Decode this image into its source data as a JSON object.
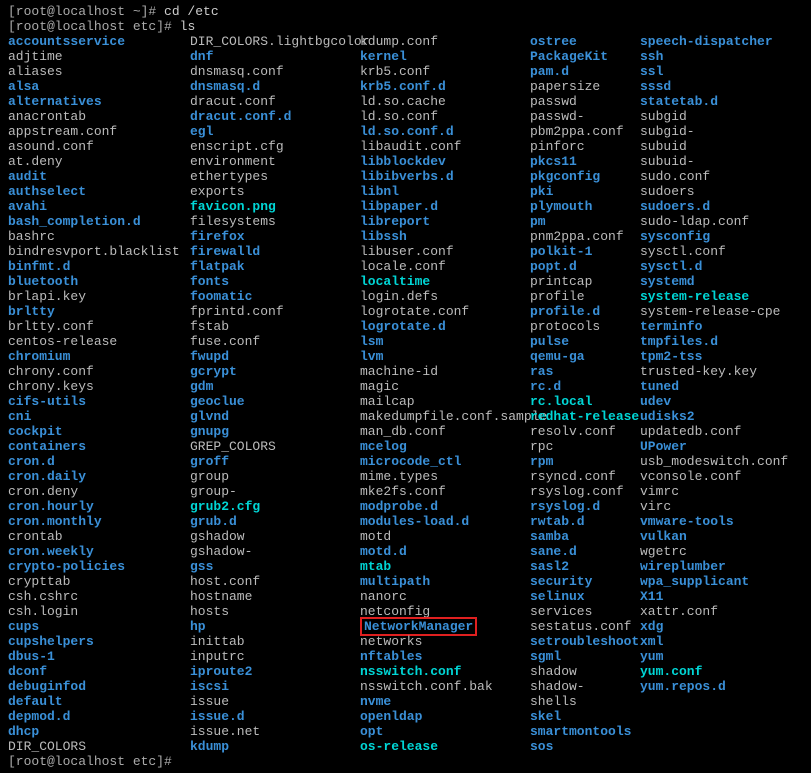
{
  "prompt1": "[root@localhost ~]# ",
  "cmd1": "cd /etc",
  "prompt2": "[root@localhost etc]# ",
  "cmd2": "ls",
  "prompt3": "[root@localhost etc]# ",
  "highlighted": "NetworkManager",
  "cols": [
    [
      {
        "t": "accountsservice",
        "c": "dir"
      },
      {
        "t": "adjtime",
        "c": ""
      },
      {
        "t": "aliases",
        "c": ""
      },
      {
        "t": "alsa",
        "c": "dir"
      },
      {
        "t": "alternatives",
        "c": "dir"
      },
      {
        "t": "anacrontab",
        "c": ""
      },
      {
        "t": "appstream.conf",
        "c": ""
      },
      {
        "t": "asound.conf",
        "c": ""
      },
      {
        "t": "at.deny",
        "c": ""
      },
      {
        "t": "audit",
        "c": "dir"
      },
      {
        "t": "authselect",
        "c": "dir"
      },
      {
        "t": "avahi",
        "c": "dir"
      },
      {
        "t": "bash_completion.d",
        "c": "dir"
      },
      {
        "t": "bashrc",
        "c": ""
      },
      {
        "t": "bindresvport.blacklist",
        "c": ""
      },
      {
        "t": "binfmt.d",
        "c": "dir"
      },
      {
        "t": "bluetooth",
        "c": "dir"
      },
      {
        "t": "brlapi.key",
        "c": ""
      },
      {
        "t": "brltty",
        "c": "dir"
      },
      {
        "t": "brltty.conf",
        "c": ""
      },
      {
        "t": "centos-release",
        "c": ""
      },
      {
        "t": "chromium",
        "c": "dir"
      },
      {
        "t": "chrony.conf",
        "c": ""
      },
      {
        "t": "chrony.keys",
        "c": ""
      },
      {
        "t": "cifs-utils",
        "c": "dir"
      },
      {
        "t": "cni",
        "c": "dir"
      },
      {
        "t": "cockpit",
        "c": "dir"
      },
      {
        "t": "containers",
        "c": "dir"
      },
      {
        "t": "cron.d",
        "c": "dir"
      },
      {
        "t": "cron.daily",
        "c": "dir"
      },
      {
        "t": "cron.deny",
        "c": ""
      },
      {
        "t": "cron.hourly",
        "c": "dir"
      },
      {
        "t": "cron.monthly",
        "c": "dir"
      },
      {
        "t": "crontab",
        "c": ""
      },
      {
        "t": "cron.weekly",
        "c": "dir"
      },
      {
        "t": "crypto-policies",
        "c": "dir"
      },
      {
        "t": "crypttab",
        "c": ""
      },
      {
        "t": "csh.cshrc",
        "c": ""
      },
      {
        "t": "csh.login",
        "c": ""
      },
      {
        "t": "cups",
        "c": "dir"
      },
      {
        "t": "cupshelpers",
        "c": "dir"
      },
      {
        "t": "dbus-1",
        "c": "dir"
      },
      {
        "t": "dconf",
        "c": "dir"
      },
      {
        "t": "debuginfod",
        "c": "dir"
      },
      {
        "t": "default",
        "c": "dir"
      },
      {
        "t": "depmod.d",
        "c": "dir"
      },
      {
        "t": "dhcp",
        "c": "dir"
      },
      {
        "t": "DIR_COLORS",
        "c": ""
      }
    ],
    [
      {
        "t": "DIR_COLORS.lightbgcolor",
        "c": ""
      },
      {
        "t": "dnf",
        "c": "dir"
      },
      {
        "t": "dnsmasq.conf",
        "c": ""
      },
      {
        "t": "dnsmasq.d",
        "c": "dir"
      },
      {
        "t": "dracut.conf",
        "c": ""
      },
      {
        "t": "dracut.conf.d",
        "c": "dir"
      },
      {
        "t": "egl",
        "c": "dir"
      },
      {
        "t": "enscript.cfg",
        "c": ""
      },
      {
        "t": "environment",
        "c": ""
      },
      {
        "t": "ethertypes",
        "c": ""
      },
      {
        "t": "exports",
        "c": ""
      },
      {
        "t": "favicon.png",
        "c": "link"
      },
      {
        "t": "filesystems",
        "c": ""
      },
      {
        "t": "firefox",
        "c": "dir"
      },
      {
        "t": "firewalld",
        "c": "dir"
      },
      {
        "t": "flatpak",
        "c": "dir"
      },
      {
        "t": "fonts",
        "c": "dir"
      },
      {
        "t": "foomatic",
        "c": "dir"
      },
      {
        "t": "fprintd.conf",
        "c": ""
      },
      {
        "t": "fstab",
        "c": ""
      },
      {
        "t": "fuse.conf",
        "c": ""
      },
      {
        "t": "fwupd",
        "c": "dir"
      },
      {
        "t": "gcrypt",
        "c": "dir"
      },
      {
        "t": "gdm",
        "c": "dir"
      },
      {
        "t": "geoclue",
        "c": "dir"
      },
      {
        "t": "glvnd",
        "c": "dir"
      },
      {
        "t": "gnupg",
        "c": "dir"
      },
      {
        "t": "GREP_COLORS",
        "c": ""
      },
      {
        "t": "groff",
        "c": "dir"
      },
      {
        "t": "group",
        "c": ""
      },
      {
        "t": "group-",
        "c": ""
      },
      {
        "t": "grub2.cfg",
        "c": "link"
      },
      {
        "t": "grub.d",
        "c": "dir"
      },
      {
        "t": "gshadow",
        "c": ""
      },
      {
        "t": "gshadow-",
        "c": ""
      },
      {
        "t": "gss",
        "c": "dir"
      },
      {
        "t": "host.conf",
        "c": ""
      },
      {
        "t": "hostname",
        "c": ""
      },
      {
        "t": "hosts",
        "c": ""
      },
      {
        "t": "hp",
        "c": "dir"
      },
      {
        "t": "inittab",
        "c": ""
      },
      {
        "t": "inputrc",
        "c": ""
      },
      {
        "t": "iproute2",
        "c": "dir"
      },
      {
        "t": "iscsi",
        "c": "dir"
      },
      {
        "t": "issue",
        "c": ""
      },
      {
        "t": "issue.d",
        "c": "dir"
      },
      {
        "t": "issue.net",
        "c": ""
      },
      {
        "t": "kdump",
        "c": "dir"
      }
    ],
    [
      {
        "t": "kdump.conf",
        "c": ""
      },
      {
        "t": "kernel",
        "c": "dir"
      },
      {
        "t": "krb5.conf",
        "c": ""
      },
      {
        "t": "krb5.conf.d",
        "c": "dir"
      },
      {
        "t": "ld.so.cache",
        "c": ""
      },
      {
        "t": "ld.so.conf",
        "c": ""
      },
      {
        "t": "ld.so.conf.d",
        "c": "dir"
      },
      {
        "t": "libaudit.conf",
        "c": ""
      },
      {
        "t": "libblockdev",
        "c": "dir"
      },
      {
        "t": "libibverbs.d",
        "c": "dir"
      },
      {
        "t": "libnl",
        "c": "dir"
      },
      {
        "t": "libpaper.d",
        "c": "dir"
      },
      {
        "t": "libreport",
        "c": "dir"
      },
      {
        "t": "libssh",
        "c": "dir"
      },
      {
        "t": "libuser.conf",
        "c": ""
      },
      {
        "t": "locale.conf",
        "c": ""
      },
      {
        "t": "localtime",
        "c": "link"
      },
      {
        "t": "login.defs",
        "c": ""
      },
      {
        "t": "logrotate.conf",
        "c": ""
      },
      {
        "t": "logrotate.d",
        "c": "dir"
      },
      {
        "t": "lsm",
        "c": "dir"
      },
      {
        "t": "lvm",
        "c": "dir"
      },
      {
        "t": "machine-id",
        "c": ""
      },
      {
        "t": "magic",
        "c": ""
      },
      {
        "t": "mailcap",
        "c": ""
      },
      {
        "t": "makedumpfile.conf.sample",
        "c": ""
      },
      {
        "t": "man_db.conf",
        "c": ""
      },
      {
        "t": "mcelog",
        "c": "dir"
      },
      {
        "t": "microcode_ctl",
        "c": "dir"
      },
      {
        "t": "mime.types",
        "c": ""
      },
      {
        "t": "mke2fs.conf",
        "c": ""
      },
      {
        "t": "modprobe.d",
        "c": "dir"
      },
      {
        "t": "modules-load.d",
        "c": "dir"
      },
      {
        "t": "motd",
        "c": ""
      },
      {
        "t": "motd.d",
        "c": "dir"
      },
      {
        "t": "mtab",
        "c": "link"
      },
      {
        "t": "multipath",
        "c": "dir"
      },
      {
        "t": "nanorc",
        "c": ""
      },
      {
        "t": "netconfig",
        "c": ""
      },
      {
        "t": "NetworkManager",
        "c": "dir",
        "hl": true
      },
      {
        "t": "networks",
        "c": ""
      },
      {
        "t": "nftables",
        "c": "dir"
      },
      {
        "t": "nsswitch.conf",
        "c": "link"
      },
      {
        "t": "nsswitch.conf.bak",
        "c": ""
      },
      {
        "t": "nvme",
        "c": "dir"
      },
      {
        "t": "openldap",
        "c": "dir"
      },
      {
        "t": "opt",
        "c": "dir"
      },
      {
        "t": "os-release",
        "c": "link"
      }
    ],
    [
      {
        "t": "ostree",
        "c": "dir"
      },
      {
        "t": "PackageKit",
        "c": "dir"
      },
      {
        "t": "pam.d",
        "c": "dir"
      },
      {
        "t": "papersize",
        "c": ""
      },
      {
        "t": "passwd",
        "c": ""
      },
      {
        "t": "passwd-",
        "c": ""
      },
      {
        "t": "pbm2ppa.conf",
        "c": ""
      },
      {
        "t": "pinforc",
        "c": ""
      },
      {
        "t": "pkcs11",
        "c": "dir"
      },
      {
        "t": "pkgconfig",
        "c": "dir"
      },
      {
        "t": "pki",
        "c": "dir"
      },
      {
        "t": "plymouth",
        "c": "dir"
      },
      {
        "t": "pm",
        "c": "dir"
      },
      {
        "t": "pnm2ppa.conf",
        "c": ""
      },
      {
        "t": "polkit-1",
        "c": "dir"
      },
      {
        "t": "popt.d",
        "c": "dir"
      },
      {
        "t": "printcap",
        "c": ""
      },
      {
        "t": "profile",
        "c": ""
      },
      {
        "t": "profile.d",
        "c": "dir"
      },
      {
        "t": "protocols",
        "c": ""
      },
      {
        "t": "pulse",
        "c": "dir"
      },
      {
        "t": "qemu-ga",
        "c": "dir"
      },
      {
        "t": "ras",
        "c": "dir"
      },
      {
        "t": "rc.d",
        "c": "dir"
      },
      {
        "t": "rc.local",
        "c": "link"
      },
      {
        "t": "redhat-release",
        "c": "link"
      },
      {
        "t": "resolv.conf",
        "c": ""
      },
      {
        "t": "rpc",
        "c": ""
      },
      {
        "t": "rpm",
        "c": "dir"
      },
      {
        "t": "rsyncd.conf",
        "c": ""
      },
      {
        "t": "rsyslog.conf",
        "c": ""
      },
      {
        "t": "rsyslog.d",
        "c": "dir"
      },
      {
        "t": "rwtab.d",
        "c": "dir"
      },
      {
        "t": "samba",
        "c": "dir"
      },
      {
        "t": "sane.d",
        "c": "dir"
      },
      {
        "t": "sasl2",
        "c": "dir"
      },
      {
        "t": "security",
        "c": "dir"
      },
      {
        "t": "selinux",
        "c": "dir"
      },
      {
        "t": "services",
        "c": ""
      },
      {
        "t": "sestatus.conf",
        "c": ""
      },
      {
        "t": "setroubleshoot",
        "c": "dir"
      },
      {
        "t": "sgml",
        "c": "dir"
      },
      {
        "t": "shadow",
        "c": ""
      },
      {
        "t": "shadow-",
        "c": ""
      },
      {
        "t": "shells",
        "c": ""
      },
      {
        "t": "skel",
        "c": "dir"
      },
      {
        "t": "smartmontools",
        "c": "dir"
      },
      {
        "t": "sos",
        "c": "dir"
      }
    ],
    [
      {
        "t": "speech-dispatcher",
        "c": "dir"
      },
      {
        "t": "ssh",
        "c": "dir"
      },
      {
        "t": "ssl",
        "c": "dir"
      },
      {
        "t": "sssd",
        "c": "dir"
      },
      {
        "t": "statetab.d",
        "c": "dir"
      },
      {
        "t": "subgid",
        "c": ""
      },
      {
        "t": "subgid-",
        "c": ""
      },
      {
        "t": "subuid",
        "c": ""
      },
      {
        "t": "subuid-",
        "c": ""
      },
      {
        "t": "sudo.conf",
        "c": ""
      },
      {
        "t": "sudoers",
        "c": ""
      },
      {
        "t": "sudoers.d",
        "c": "dir"
      },
      {
        "t": "sudo-ldap.conf",
        "c": ""
      },
      {
        "t": "sysconfig",
        "c": "dir"
      },
      {
        "t": "sysctl.conf",
        "c": ""
      },
      {
        "t": "sysctl.d",
        "c": "dir"
      },
      {
        "t": "systemd",
        "c": "dir"
      },
      {
        "t": "system-release",
        "c": "link"
      },
      {
        "t": "system-release-cpe",
        "c": ""
      },
      {
        "t": "terminfo",
        "c": "dir"
      },
      {
        "t": "tmpfiles.d",
        "c": "dir"
      },
      {
        "t": "tpm2-tss",
        "c": "dir"
      },
      {
        "t": "trusted-key.key",
        "c": ""
      },
      {
        "t": "tuned",
        "c": "dir"
      },
      {
        "t": "udev",
        "c": "dir"
      },
      {
        "t": "udisks2",
        "c": "dir"
      },
      {
        "t": "updatedb.conf",
        "c": ""
      },
      {
        "t": "UPower",
        "c": "dir"
      },
      {
        "t": "usb_modeswitch.conf",
        "c": ""
      },
      {
        "t": "vconsole.conf",
        "c": ""
      },
      {
        "t": "vimrc",
        "c": ""
      },
      {
        "t": "virc",
        "c": ""
      },
      {
        "t": "vmware-tools",
        "c": "dir"
      },
      {
        "t": "vulkan",
        "c": "dir"
      },
      {
        "t": "wgetrc",
        "c": ""
      },
      {
        "t": "wireplumber",
        "c": "dir"
      },
      {
        "t": "wpa_supplicant",
        "c": "dir"
      },
      {
        "t": "X11",
        "c": "dir"
      },
      {
        "t": "xattr.conf",
        "c": ""
      },
      {
        "t": "xdg",
        "c": "dir"
      },
      {
        "t": "xml",
        "c": "dir"
      },
      {
        "t": "yum",
        "c": "dir"
      },
      {
        "t": "yum.conf",
        "c": "link"
      },
      {
        "t": "yum.repos.d",
        "c": "dir"
      }
    ]
  ]
}
